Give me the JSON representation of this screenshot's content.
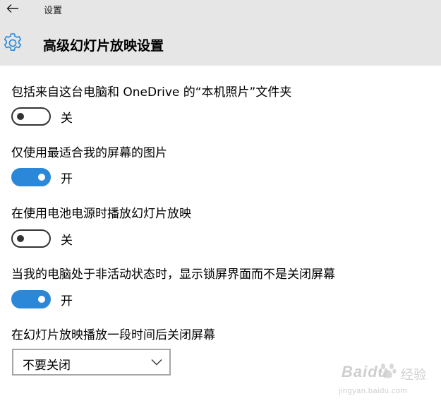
{
  "window": {
    "app_title": "设置",
    "back_icon": "back-arrow-icon"
  },
  "header": {
    "icon": "gear-icon",
    "title": "高级幻灯片放映设置"
  },
  "settings": [
    {
      "label": "包括来自这台电脑和 OneDrive 的“本机照片”文件夹",
      "on": false,
      "state_text": "关"
    },
    {
      "label": "仅使用最适合我的屏幕的图片",
      "on": true,
      "state_text": "开"
    },
    {
      "label": "在使用电池电源时播放幻灯片放映",
      "on": false,
      "state_text": "关"
    },
    {
      "label": "当我的电脑处于非活动状态时，显示锁屏界面而不是关闭屏幕",
      "on": true,
      "state_text": "开"
    }
  ],
  "screen_off": {
    "label": "在幻灯片放映播放一段时间后关闭屏幕",
    "selected": "不要关闭",
    "icon": "chevron-down-icon"
  },
  "watermark": {
    "brand": "Baidu",
    "brand_cn": "经验",
    "url": "jingyan.baidu.com"
  },
  "colors": {
    "accent": "#2b88d8",
    "header_bg": "#e6e6e6",
    "toggle_off": "#333333"
  }
}
